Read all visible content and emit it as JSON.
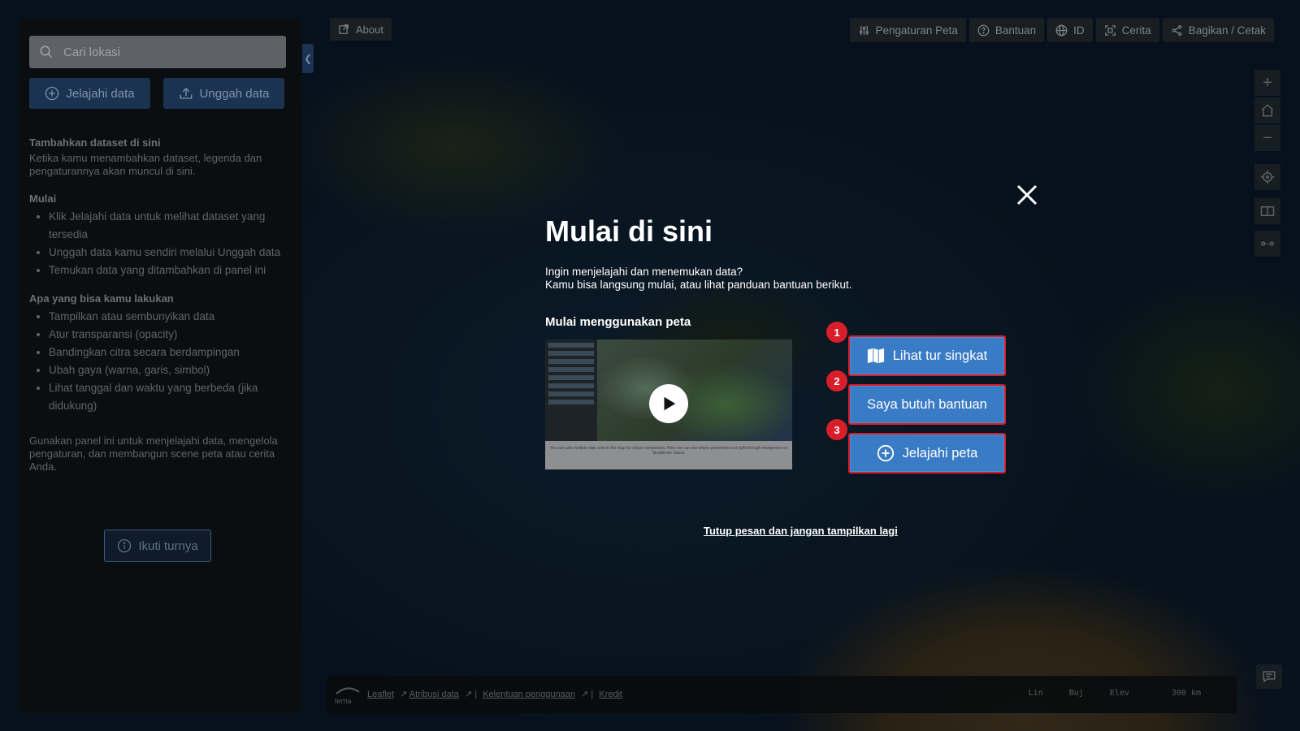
{
  "search": {
    "placeholder": "Cari lokasi"
  },
  "panel": {
    "explore_label": "Jelajahi data",
    "upload_label": "Unggah data",
    "add_heading": "Tambahkan dataset di sini",
    "add_text": "Ketika kamu menambahkan dataset, legenda dan pengaturannya akan muncul di sini.",
    "start_heading": "Mulai",
    "start_items": [
      "Klik Jelajahi data untuk melihat dataset yang tersedia",
      "Unggah data kamu sendiri melalui Unggah data",
      "Temukan data yang ditambahkan di panel ini"
    ],
    "can_heading": "Apa yang bisa kamu lakukan",
    "can_items": [
      "Tampilkan atau sembunyikan data",
      "Atur transparansi (opacity)",
      "Bandingkan citra secara berdampingan",
      "Ubah gaya (warna, garis, simbol)",
      "Lihat tanggal dan waktu yang berbeda (jika didukung)"
    ],
    "footer_text": "Gunakan panel ini untuk menjelajahi data, mengelola pengaturan, dan membangun scene peta atau cerita Anda.",
    "tour_label": "Ikuti turnya"
  },
  "toolbar": {
    "about_label": "About",
    "map_settings": "Pengaturan Peta",
    "help": "Bantuan",
    "language": "ID",
    "story": "Cerita",
    "share": "Bagikan / Cetak"
  },
  "modal": {
    "title": "Mulai di sini",
    "desc_line1": "Ingin menjelajahi dan menemukan data?",
    "desc_line2": "Kamu bisa langsung mulai, atau lihat panduan bantuan berikut.",
    "subtitle": "Mulai menggunakan peta",
    "video_caption": "You can add multiple data sets to the map for visual comparison. Here we can see where powerlines cut right through mangroves on Stradbroke Island.",
    "actions": [
      {
        "number": "1",
        "label": "Lihat tur singkat"
      },
      {
        "number": "2",
        "label": "Saya butuh bantuan"
      },
      {
        "number": "3",
        "label": "Jelajahi peta"
      }
    ],
    "dismiss_label": "Tutup pesan dan jangan tampilkan lagi"
  },
  "bottom": {
    "logo_text": "terria",
    "leaflet": "Leaflet",
    "attribution": "Atribusi data",
    "terms": "Kelentuan penggunaan",
    "credit": "Kredit",
    "sep": "|",
    "lat_label": "Lin",
    "lon_label": "Buj",
    "elev_label": "Elev",
    "scale": "300 km"
  },
  "colors": {
    "accent_button": "#3a7bc6",
    "highlight_border": "#d81e2a",
    "panel_button": "#1b3350"
  }
}
